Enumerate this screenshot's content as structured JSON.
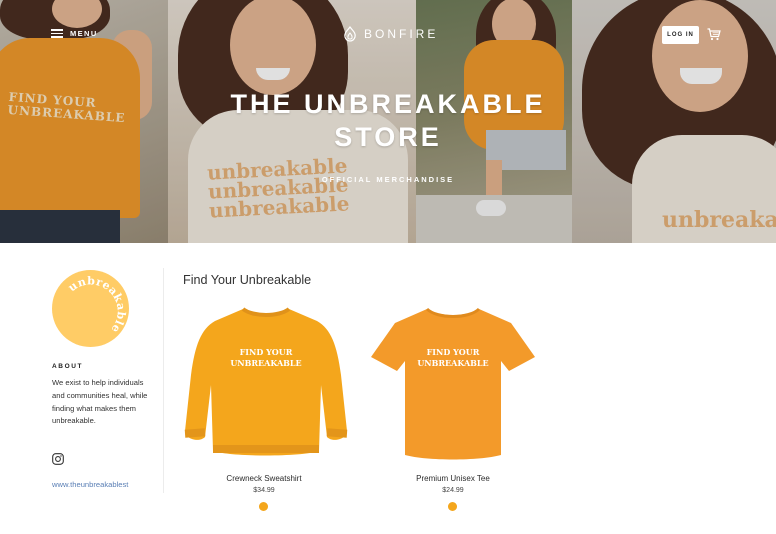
{
  "header": {
    "menu_label": "MENU",
    "brand_name": "BONFIRE",
    "login_label": "LOG IN"
  },
  "hero": {
    "title_line1": "THE UNBREAKABLE",
    "title_line2": "STORE",
    "subtitle": "OFFICIAL MERCHANDISE",
    "shirt_print_line1": "FIND YOUR",
    "shirt_print_line2": "UNBREAKABLE",
    "cream_print": "unbreakable"
  },
  "sidebar": {
    "logo_text": "unbreakable",
    "about_heading": "ABOUT",
    "about_text": "We exist to help individuals and communities heal, while finding what makes them unbreakable.",
    "website": "www.theunbreakablest"
  },
  "main": {
    "section_title": "Find Your Unbreakable",
    "products": [
      {
        "name": "Crewneck Sweatshirt",
        "price": "$34.99",
        "print_line1": "FIND YOUR",
        "print_line2": "UNBREAKABLE",
        "color": "#f4a61c"
      },
      {
        "name": "Premium Unisex Tee",
        "price": "$24.99",
        "print_line1": "FIND YOUR",
        "print_line2": "UNBREAKABLE",
        "color": "#f4a61c"
      }
    ]
  },
  "colors": {
    "accent": "#f4a61c",
    "logo_circle": "#ffcc66",
    "link": "#5a7fb5"
  }
}
